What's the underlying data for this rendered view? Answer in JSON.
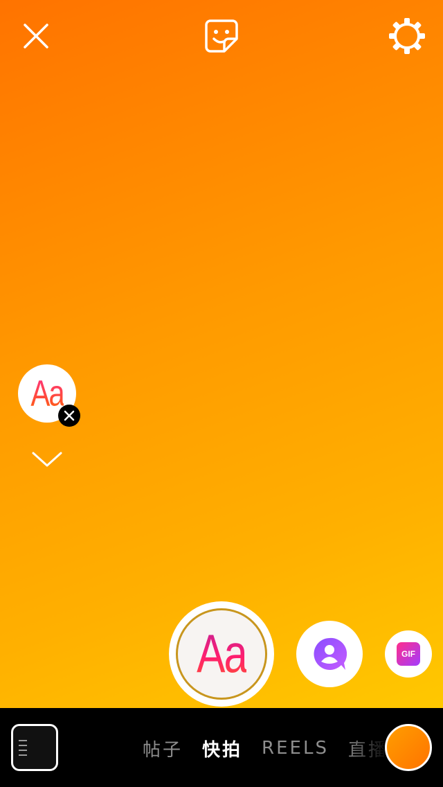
{
  "top_bar": {
    "close_icon": "close-icon",
    "sticker_icon": "sticker-icon",
    "settings_icon": "gear-icon"
  },
  "text_style": {
    "label": "Aa"
  },
  "tools": {
    "text_label": "Aa",
    "mention_icon": "person-mention-icon",
    "gif_label": "GIF"
  },
  "bottom_bar": {
    "modes": [
      {
        "label": "帖子",
        "active": false
      },
      {
        "label": "快拍",
        "active": true
      },
      {
        "label": "REELS",
        "active": false
      },
      {
        "label": "直播",
        "active": false
      }
    ]
  },
  "colors": {
    "gradient_start": "#ff7300",
    "gradient_end": "#ffc800",
    "accent_pink": "#ff2e8a"
  }
}
